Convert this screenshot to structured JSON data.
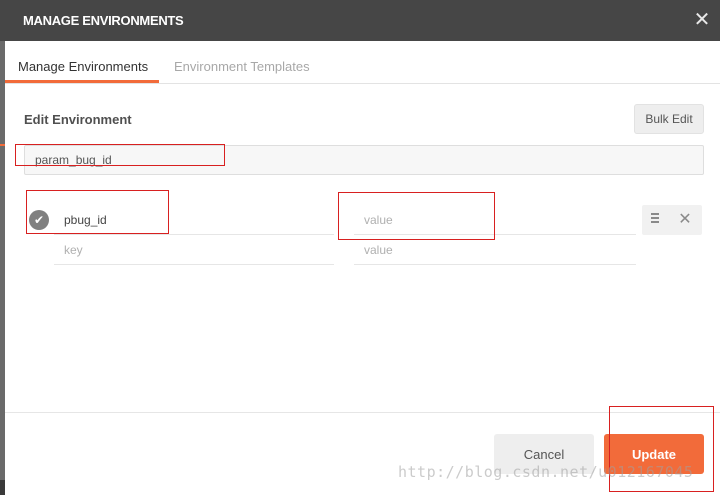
{
  "window": {
    "title": "MANAGE ENVIRONMENTS",
    "close_icon": "close-icon"
  },
  "tabs": [
    {
      "label": "Manage Environments",
      "active": true
    },
    {
      "label": "Environment Templates",
      "active": false
    }
  ],
  "editor": {
    "section_title": "Edit Environment",
    "bulk_edit_label": "Bulk Edit",
    "environment_name": "param_bug_id"
  },
  "variables": [
    {
      "key": "pbug_id",
      "value": "",
      "value_placeholder": "value",
      "enabled": true
    },
    {
      "key": "",
      "key_placeholder": "key",
      "value": "",
      "value_placeholder": "value",
      "enabled": false
    }
  ],
  "footer": {
    "cancel_label": "Cancel",
    "update_label": "Update"
  },
  "watermark": "http://blog.csdn.net/u012167045",
  "colors": {
    "titlebar": "#464646",
    "accent": "#f26b3a",
    "annotation": "#d82020"
  }
}
